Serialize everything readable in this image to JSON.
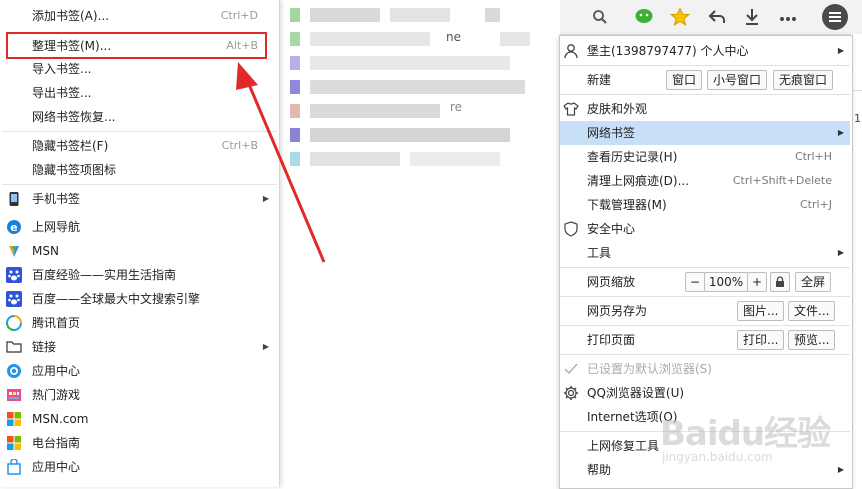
{
  "bookmarks_menu": {
    "items": [
      {
        "label": "添加书签(A)...",
        "shortcut": "Ctrl+D"
      },
      {
        "label": "整理书签(M)...",
        "shortcut": "Alt+B"
      },
      {
        "label": "导入书签..."
      },
      {
        "label": "导出书签..."
      },
      {
        "label": "网络书签恢复..."
      },
      {
        "label": "隐藏书签栏(F)",
        "shortcut": "Ctrl+B"
      },
      {
        "label": "隐藏书签项图标"
      },
      {
        "label": "手机书签",
        "icon": "phone-icon"
      },
      {
        "label": "上网导航",
        "icon": "ie-e-icon"
      },
      {
        "label": "MSN",
        "icon": "msn-butterfly-icon"
      },
      {
        "label": "百度经验——实用生活指南",
        "icon": "baidu-paw-icon"
      },
      {
        "label": "百度——全球最大中文搜索引擎",
        "icon": "baidu-paw-icon"
      },
      {
        "label": "腾讯首页",
        "icon": "tencent-icon"
      },
      {
        "label": "链接",
        "icon": "folder-icon"
      },
      {
        "label": "应用中心",
        "icon": "app-center-icon"
      },
      {
        "label": "热门游戏",
        "icon": "game-icon"
      },
      {
        "label": "MSN.com",
        "icon": "windows-icon"
      },
      {
        "label": "电台指南",
        "icon": "windows-icon"
      },
      {
        "label": "应用中心",
        "icon": "bag-icon"
      }
    ]
  },
  "blurred_fragments": {
    "text_a": "ne",
    "text_b": "re"
  },
  "toolbar": {
    "icons": [
      "search-icon",
      "wechat-icon",
      "star-icon",
      "back-icon",
      "download-icon",
      "more-icon",
      "menu-icon"
    ]
  },
  "main_menu": {
    "user": {
      "label": "堡主(1398797477) 个人中心"
    },
    "new_window": {
      "label": "新建",
      "btn_window": "窗口",
      "btn_small": "小号窗口",
      "btn_incognito": "无痕窗口"
    },
    "skin": {
      "label": "皮肤和外观"
    },
    "network_bookmarks": {
      "label": "网络书签"
    },
    "history": {
      "label": "查看历史记录(H)",
      "shortcut": "Ctrl+H"
    },
    "clear": {
      "label": "清理上网痕迹(D)...",
      "shortcut": "Ctrl+Shift+Delete"
    },
    "downloads": {
      "label": "下载管理器(M)",
      "shortcut": "Ctrl+J"
    },
    "security": {
      "label": "安全中心"
    },
    "tools": {
      "label": "工具"
    },
    "zoom": {
      "label": "网页缩放",
      "minus": "−",
      "value": "100%",
      "plus": "+",
      "full": "全屏"
    },
    "save_as": {
      "label": "网页另存为",
      "btn_image": "图片...",
      "btn_file": "文件..."
    },
    "print": {
      "label": "打印页面",
      "btn_print": "打印...",
      "btn_preview": "预览..."
    },
    "default_browser": {
      "label": "已设置为默认浏览器(S)"
    },
    "settings": {
      "label": "QQ浏览器设置(U)"
    },
    "internet_options": {
      "label": "Internet选项(O)"
    },
    "repair": {
      "label": "上网修复工具"
    },
    "help": {
      "label": "帮助"
    }
  },
  "watermark": {
    "logo": "Baidu经验",
    "url": "jingyan.baidu.com"
  },
  "colors": {
    "annotation_red": "#e02a2a",
    "menu_highlight": "#c7e0f7",
    "wechat_green": "#3cb035",
    "star_yellow": "#f6b400"
  }
}
